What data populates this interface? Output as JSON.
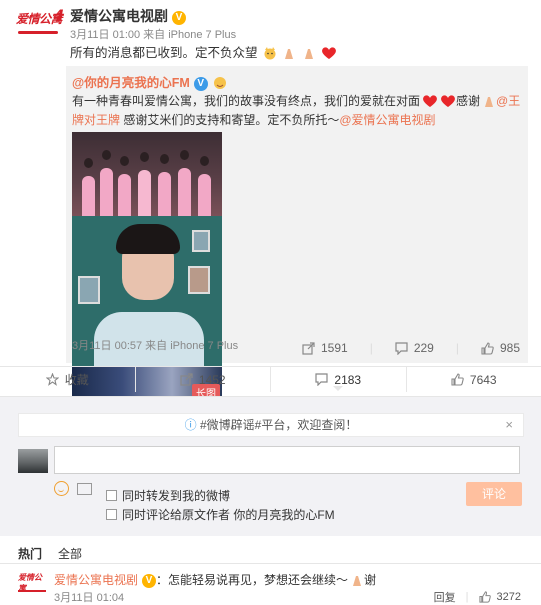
{
  "post": {
    "author": "爱情公寓电视剧",
    "verified_badge": "V",
    "meta": "3月11日 01:00 来自 iPhone 7 Plus",
    "text": "所有的消息都已收到。定不负众望"
  },
  "repost": {
    "author": "@你的月亮我的心FM",
    "verified_badge": "V",
    "text_1": "有一种青春叫爱情公寓，我们的故事没有终点，我们的爱就在对面",
    "text_2": "感谢",
    "mention_1": "@王牌对王牌",
    "text_3": " 感谢艾米们的支持和寄望。定不负所托～",
    "mention_2": "@爱情公寓电视剧",
    "long_image_tag": "长图",
    "meta": "3月11日 00:57 来自 iPhone 7 Plus",
    "share_count": "1591",
    "comment_count": "229",
    "like_count": "985"
  },
  "actionbar": {
    "favorite": "收藏",
    "share": "1452",
    "comment": "2183",
    "like": "7643"
  },
  "comment_box": {
    "notice": "#微博辟谣#平台，欢迎查阅！",
    "close": "×",
    "input_value": "",
    "option_1": "同时转发到我的微博",
    "option_2": "同时评论给原文作者 你的月亮我的心FM",
    "submit": "评论"
  },
  "tabs": {
    "hot": "热门",
    "all": "全部"
  },
  "first_comment": {
    "author": "爱情公寓电视剧",
    "verified_badge": "V",
    "text": "：怎能轻易说再见，梦想还会继续～",
    "text_end": "谢",
    "date": "3月11日 01:04",
    "reply": "回复",
    "like_count": "3272"
  },
  "colors": {
    "accent": "#eb7350",
    "brand_red": "#d6202a",
    "verified_gold": "#ffb400",
    "submit_bg": "#ffc09f"
  }
}
